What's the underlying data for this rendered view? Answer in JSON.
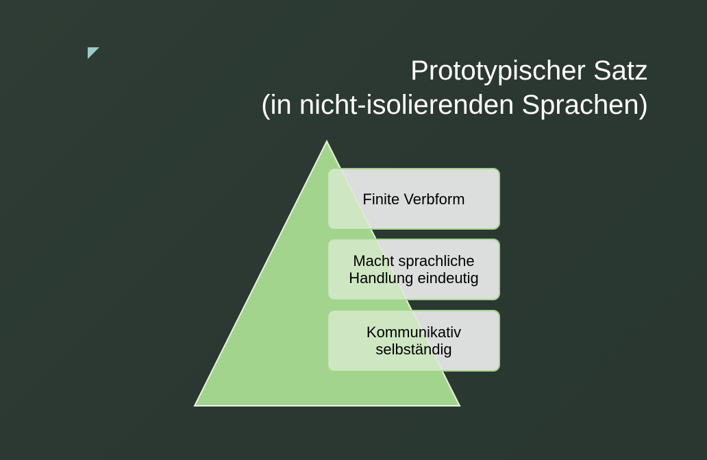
{
  "slide": {
    "title_line_1": "Prototypischer Satz",
    "title_line_2": "(in nicht-isolierenden Sprachen)",
    "corner_icon": "triangle-corner-icon"
  },
  "pyramid": {
    "levels": [
      {
        "line_1": "Finite Verbform",
        "line_2": ""
      },
      {
        "line_1": "Macht sprachliche",
        "line_2": "Handlung eindeutig"
      },
      {
        "line_1": "Kommunikativ",
        "line_2": "selbständig"
      }
    ]
  },
  "colors": {
    "background": "#2c3a33",
    "pyramid_fill": "#a3d48e",
    "box_fill": "#ebebeb",
    "box_border": "#a3d48e",
    "accent": "#9ec9c9",
    "title_text": "#ffffff"
  }
}
